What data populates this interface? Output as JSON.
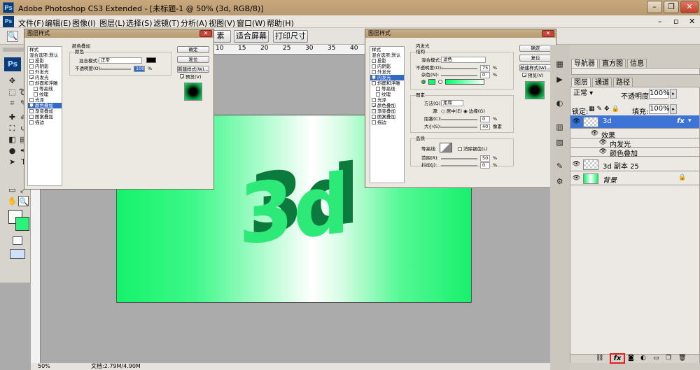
{
  "app": {
    "logo": "Ps",
    "title": "Adobe Photoshop CS3 Extended - [未标题-1 @ 50% (3d, RGB/8)]"
  },
  "window_controls": {
    "minimize": "–",
    "restore": "❐",
    "close": "✕"
  },
  "menu": [
    "文件(F)",
    "编辑(E)",
    "图像(I)",
    "图层(L)",
    "选择(S)",
    "滤镜(T)",
    "分析(A)",
    "视图(V)",
    "窗口(W)",
    "帮助(H)"
  ],
  "doc_controls": {
    "minimize": "–",
    "restore": "▫",
    "close": "✕"
  },
  "options": {
    "btn1": "素",
    "btn2": "适合屏幕",
    "btn3": "打印尺寸"
  },
  "ruler_top": [
    "10",
    "15",
    "20",
    "25",
    "30",
    "35",
    "40"
  ],
  "canvas": {
    "text": "3d"
  },
  "dialog1": {
    "title": "图层样式",
    "close": "✕",
    "styles": [
      {
        "label": "样式",
        "checked": false,
        "hasbox": false,
        "selected": false
      },
      {
        "label": "混合选项:默认",
        "checked": false,
        "hasbox": false,
        "selected": false
      },
      {
        "label": "投影",
        "checked": false,
        "hasbox": true,
        "selected": false
      },
      {
        "label": "内阴影",
        "checked": false,
        "hasbox": true,
        "selected": false
      },
      {
        "label": "外发光",
        "checked": false,
        "hasbox": true,
        "selected": false
      },
      {
        "label": "内发光",
        "checked": true,
        "hasbox": true,
        "selected": false
      },
      {
        "label": "斜面和浮雕",
        "checked": false,
        "hasbox": true,
        "selected": false
      },
      {
        "label": "等高线",
        "checked": false,
        "hasbox": true,
        "selected": false
      },
      {
        "label": "纹理",
        "checked": false,
        "hasbox": true,
        "selected": false
      },
      {
        "label": "光泽",
        "checked": false,
        "hasbox": true,
        "selected": false
      },
      {
        "label": "颜色叠加",
        "checked": true,
        "hasbox": true,
        "selected": true
      },
      {
        "label": "渐变叠加",
        "checked": false,
        "hasbox": true,
        "selected": false
      },
      {
        "label": "图案叠加",
        "checked": false,
        "hasbox": true,
        "selected": false
      },
      {
        "label": "描边",
        "checked": false,
        "hasbox": true,
        "selected": false
      }
    ],
    "section": "颜色叠加",
    "subsection": "颜色",
    "blend_label": "混合模式:",
    "blend_value": "正常",
    "opacity_label": "不透明度(O):",
    "opacity_value": "100",
    "percent": "%",
    "color": "#000000",
    "buttons": {
      "ok": "确定",
      "reset": "复位",
      "new_style": "新建样式(W)...",
      "preview": "预览(V)"
    }
  },
  "dialog2": {
    "title": "图层样式",
    "close": "✕",
    "styles": [
      {
        "label": "样式",
        "checked": false,
        "hasbox": false,
        "selected": false
      },
      {
        "label": "混合选项:默认",
        "checked": false,
        "hasbox": false,
        "selected": false
      },
      {
        "label": "投影",
        "checked": false,
        "hasbox": true,
        "selected": false
      },
      {
        "label": "内阴影",
        "checked": false,
        "hasbox": true,
        "selected": false
      },
      {
        "label": "外发光",
        "checked": false,
        "hasbox": true,
        "selected": false
      },
      {
        "label": "内发光",
        "checked": true,
        "hasbox": true,
        "selected": true
      },
      {
        "label": "斜面和浮雕",
        "checked": false,
        "hasbox": true,
        "selected": false
      },
      {
        "label": "等高线",
        "checked": false,
        "hasbox": true,
        "selected": false
      },
      {
        "label": "纹理",
        "checked": false,
        "hasbox": true,
        "selected": false
      },
      {
        "label": "光泽",
        "checked": false,
        "hasbox": true,
        "selected": false
      },
      {
        "label": "颜色叠加",
        "checked": true,
        "hasbox": true,
        "selected": false
      },
      {
        "label": "渐变叠加",
        "checked": false,
        "hasbox": true,
        "selected": false
      },
      {
        "label": "图案叠加",
        "checked": false,
        "hasbox": true,
        "selected": false
      },
      {
        "label": "描边",
        "checked": false,
        "hasbox": true,
        "selected": false
      }
    ],
    "section": "内发光",
    "structure": "结构",
    "blend_label": "混合模式:",
    "blend_value": "滤色",
    "opacity_label": "不透明度(O):",
    "opacity_value": "75",
    "noise_label": "杂色(N):",
    "noise_value": "0",
    "percent": "%",
    "glow_color": "#00ff66",
    "elements": "图素",
    "method_label": "方法(Q):",
    "method_value": "柔和",
    "source_label": "源:",
    "source_center": "居中(E)",
    "source_edge": "边缘(G)",
    "choke_label": "阻塞(C):",
    "choke_value": "0",
    "size_label": "大小(S):",
    "size_value": "40",
    "px": "像素",
    "quality": "品质",
    "contour_label": "等高线:",
    "antialias": "消除锯齿(L)",
    "range_label": "范围(R):",
    "range_value": "50",
    "jitter_label": "抖动(J):",
    "jitter_value": "0",
    "buttons": {
      "ok": "确定",
      "reset": "复位",
      "new_style": "新建样式(W)...",
      "preview": "预览(V)"
    }
  },
  "panel": {
    "tabs_top": [
      "导航器",
      "直方图",
      "信息"
    ],
    "tabs": [
      "图层",
      "通道",
      "路径"
    ],
    "blend_mode": "正常",
    "opacity_label": "不透明度:",
    "opacity_value": "100%",
    "lock_label": "锁定:",
    "fill_label": "填充:",
    "fill_value": "100%",
    "layers": [
      {
        "name": "3d",
        "fx": "fx",
        "selected": true
      },
      {
        "name": "3d 副本 25",
        "fx": "",
        "selected": false
      },
      {
        "name": "背景",
        "fx": "",
        "selected": false
      }
    ],
    "effects": "效果",
    "effect_items": [
      "内发光",
      "颜色叠加"
    ],
    "bottom_fx": "fx"
  },
  "status": {
    "zoom": "50%",
    "doc": "文档:2.79M/4.90M"
  }
}
